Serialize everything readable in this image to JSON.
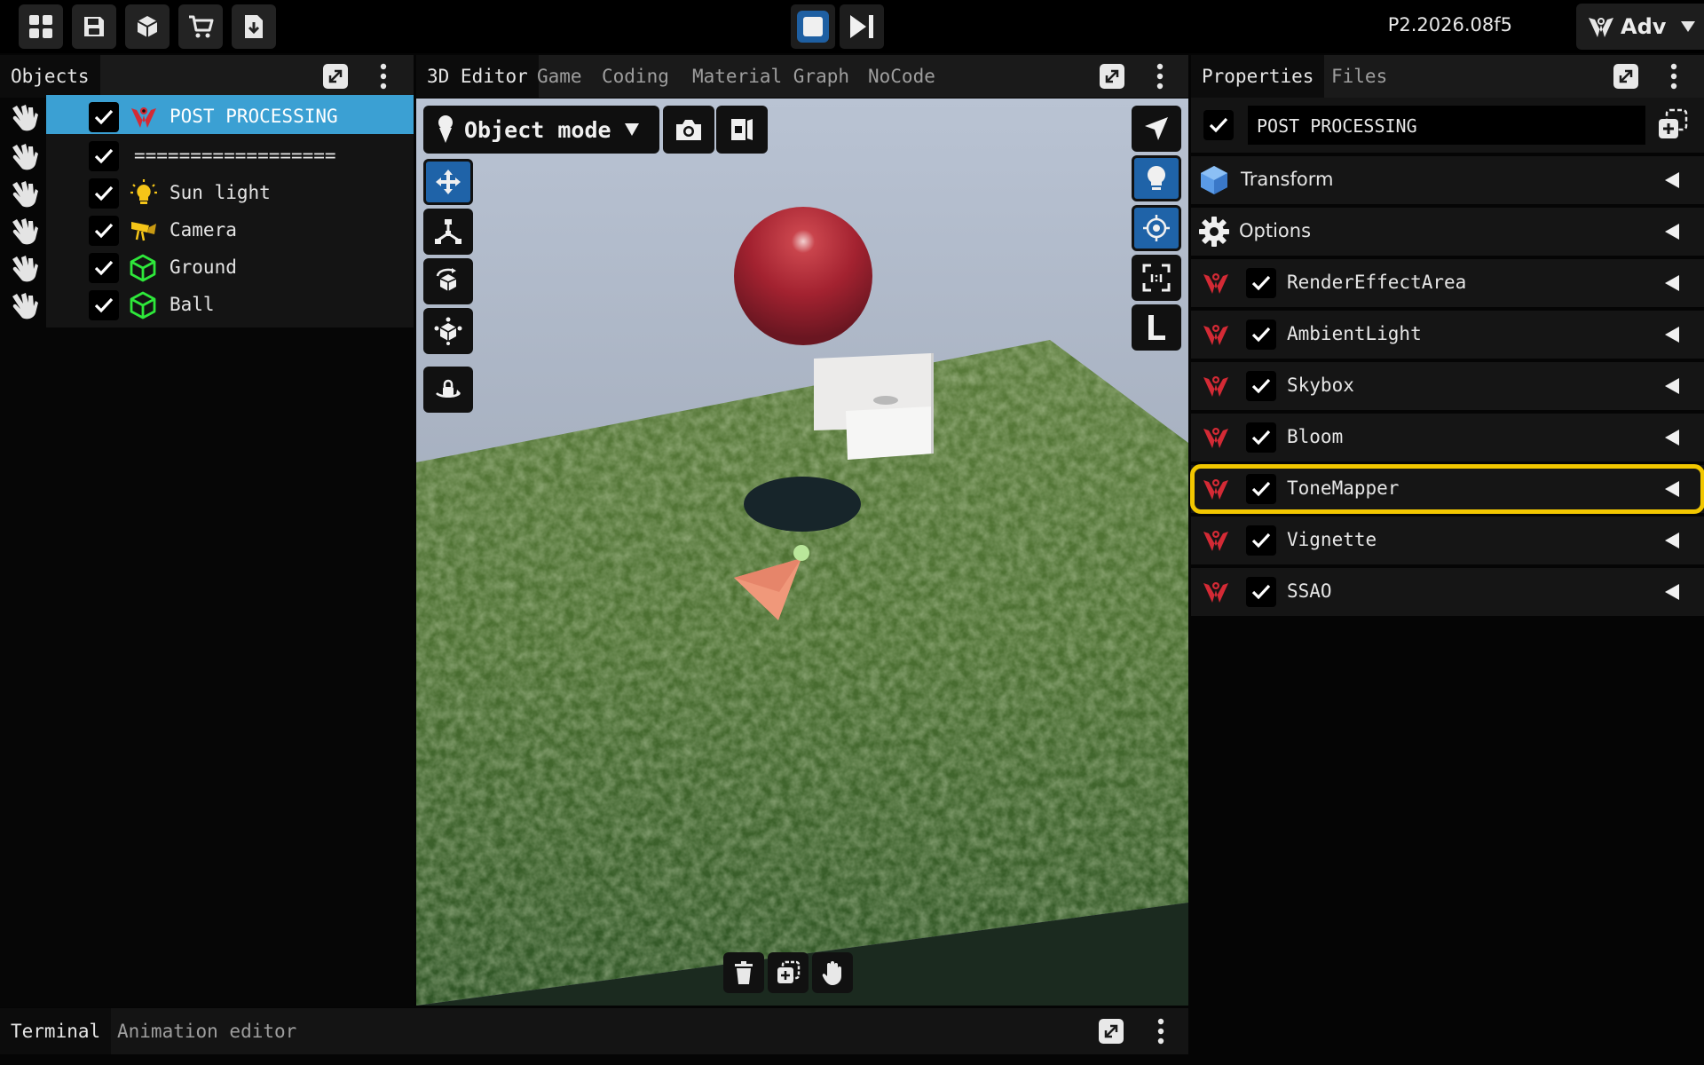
{
  "topbar": {
    "version": "P2.2026.08f5",
    "mode_menu": "Adv"
  },
  "panels": {
    "objects": {
      "title": "Objects"
    },
    "center_tabs": [
      "3D Editor",
      "Game",
      "Coding",
      "Material Graph",
      "NoCode"
    ],
    "right_tabs": [
      "Properties",
      "Files"
    ],
    "bottom_tabs": [
      "Terminal",
      "Animation editor"
    ]
  },
  "objects": [
    {
      "label": "POST PROCESSING",
      "icon": "post-processing-icon",
      "selected": true,
      "checked": true
    },
    {
      "label": "==================",
      "icon": "",
      "selected": false,
      "checked": true
    },
    {
      "label": "Sun light",
      "icon": "sun-light-icon",
      "selected": false,
      "checked": true
    },
    {
      "label": "Camera",
      "icon": "camera-icon",
      "selected": false,
      "checked": true
    },
    {
      "label": "Ground",
      "icon": "mesh-icon",
      "selected": false,
      "checked": true
    },
    {
      "label": "Ball",
      "icon": "mesh-icon",
      "selected": false,
      "checked": true
    }
  ],
  "viewport": {
    "mode": "Object mode"
  },
  "properties": {
    "name": "POST PROCESSING",
    "sections": [
      "Transform",
      "Options"
    ],
    "components": [
      {
        "label": "RenderEffectArea",
        "checked": true,
        "highlighted": false
      },
      {
        "label": "AmbientLight",
        "checked": true,
        "highlighted": false
      },
      {
        "label": "Skybox",
        "checked": true,
        "highlighted": false
      },
      {
        "label": "Bloom",
        "checked": true,
        "highlighted": false
      },
      {
        "label": "ToneMapper",
        "checked": true,
        "highlighted": true
      },
      {
        "label": "Vignette",
        "checked": true,
        "highlighted": false
      },
      {
        "label": "SSAO",
        "checked": true,
        "highlighted": false
      }
    ]
  },
  "colors": {
    "selection": "#3ba0d3",
    "highlight": "#f2c700",
    "tool_active": "#1f63a8",
    "post_processing_icon": "#d42a35",
    "mesh_icon": "#2ee83a",
    "sun_icon": "#f5c518"
  }
}
